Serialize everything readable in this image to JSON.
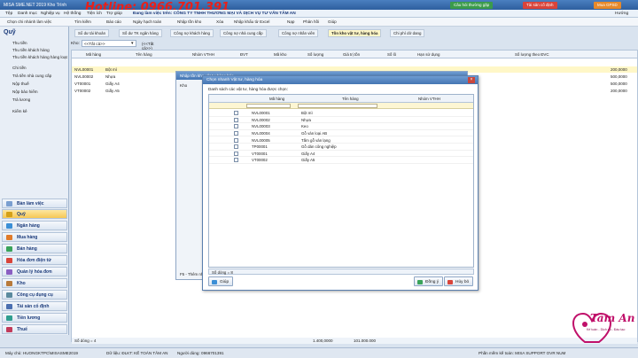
{
  "titlebar": {
    "title": "MISA SME.NET 2019 Kho Trình",
    "hotline": "Hotline: 0966.701.391",
    "btn_support": "Câu hỏi thường gặp",
    "btn_account": "Tài sản cố định",
    "btn_gpsd": "Mua GPSD"
  },
  "menubar": {
    "items": [
      "Tệp",
      "Danh mục",
      "Nghiệp vụ",
      "Hệ thống",
      "Tiện ích",
      "Trợ giúp"
    ],
    "company": "Đang làm việc trên: CÔNG TY TNHH THƯƠNG MẠI VÀ DỊCH VỤ TƯ VẤN TÂM AN",
    "right_user": "Hướng"
  },
  "toolbar": {
    "items": [
      "Chọn chi nhánh làm việc",
      "Tìm kiếm",
      "Báo cáo",
      "Ngày hạch toán",
      "Nhập tồn kho",
      "Xóa",
      "Nhập khẩu từ Excel",
      "Nạp",
      "Phản hồi",
      "Giúp"
    ]
  },
  "sidebar": {
    "title": "Quỹ",
    "items": [
      "Thu tiền",
      "Thu tiền khách hàng",
      "Thu tiền khách hàng hàng loạt",
      "Chi tiền",
      "Trả tiền nhà cung cấp",
      "Nộp thuế",
      "Nộp bảo hiểm",
      "Trả lương",
      "Kiểm kê"
    ],
    "modules": [
      "Bàn làm việc",
      "Quỹ",
      "Ngân hàng",
      "Mua hàng",
      "Bán hàng",
      "Hóa đơn điện tử",
      "Quản lý hóa đơn",
      "Kho",
      "Công cụ dụng cụ",
      "Tài sản cố định",
      "Tiền lương",
      "Thuế"
    ]
  },
  "tabs": [
    "Sổ dư tài khoản",
    "Số dư TK ngân hàng",
    "Công nợ khách hàng",
    "Công nợ nhà cung cấp",
    "Công nợ nhân viên",
    "Tồn kho vật tư, hàng hóa",
    "Chi phí dở dang"
  ],
  "kho": {
    "label": "Kho:",
    "value": "<<Tất cả>>",
    "hint": "(<<Tất cả>>)"
  },
  "main_grid": {
    "headers": [
      "Mã hàng",
      "Tên hàng",
      "Nhóm VTHH",
      "ĐVT",
      "Mã kho",
      "Số lượng",
      "Giá trị tồn",
      "Số lô",
      "Hạn sử dụng",
      "Số lượng theo ĐVC"
    ],
    "rows": [
      {
        "code": "NVL00001",
        "name": "Bột mì",
        "qty": "200,0000"
      },
      {
        "code": "NVL00002",
        "name": "Nhựa",
        "qty": "500,0000"
      },
      {
        "code": "VT00001",
        "name": "Giấy A4",
        "qty": "500,0000"
      },
      {
        "code": "VT00002",
        "name": "Giấy A5",
        "qty": "200,0000"
      }
    ],
    "footer_count": "Số dòng = 4",
    "footer_qty": "1.400,0000",
    "footer_value": "101.000.000"
  },
  "bg_window": {
    "title": "Nhập tồn kho vật tư hàng hóa",
    "kho_label": "Kho",
    "footer": "F5 - Thêm nhanh ; F3 - Tìm nhanh ; F8 - Nhập mã quy cách"
  },
  "dialog": {
    "title": "Chọn nhanh Vật tư, hàng hóa",
    "subtitle": "Danh sách các vật tư, hàng hóa được chọn:",
    "headers": [
      "Mã hàng",
      "Tên hàng",
      "Nhóm VTHH"
    ],
    "rows": [
      {
        "code": "NVL00001",
        "name": "Bột mì"
      },
      {
        "code": "NVL00002",
        "name": "Nhựa"
      },
      {
        "code": "NVL00003",
        "name": "Keo"
      },
      {
        "code": "NVL00004",
        "name": "Gỗ ván loại AB"
      },
      {
        "code": "NVL00005",
        "name": "Tấm gỗ ván lạng"
      },
      {
        "code": "TP00001",
        "name": "Gỗ dán công nghiệp"
      },
      {
        "code": "VT00001",
        "name": "Giấy A4"
      },
      {
        "code": "VT00002",
        "name": "Giấy A5"
      }
    ],
    "count": "Số dòng = 8",
    "help": "Giúp",
    "ok": "Đồng ý",
    "cancel": "Hủy bỏ"
  },
  "status": {
    "items": [
      "Máy chủ: HUONGKTPC\\MISASME2019",
      "Dữ liệu: ĐLKT: KẾ TOÁN TÂM AN",
      "Người dùng: 0966701391"
    ],
    "right": "Phần mềm kế toán: MISA SUPPORT   OVR   NUM"
  },
  "logo": {
    "text": "Tâm An",
    "sub": "Kế toán - Dịch vụ - Đào tạo"
  },
  "colors": {
    "accent": "#2e5f9e",
    "hotline": "#e8201a",
    "active_tab": "#fff7c7",
    "logo": "#c0106a"
  }
}
